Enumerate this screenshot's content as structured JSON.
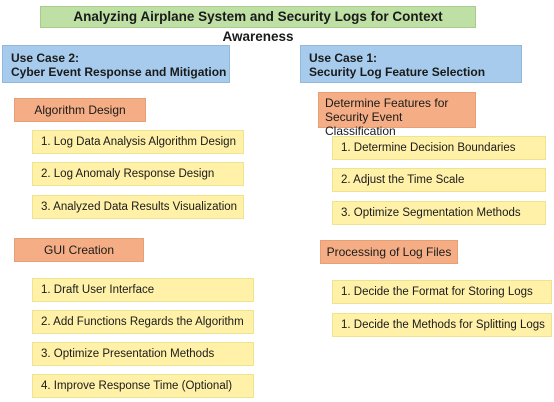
{
  "title": "Analyzing Airplane System and Security Logs for Context Awareness",
  "use_case_2": {
    "line1": "Use Case 2:",
    "line2": "Cyber Event Response and Mitigation",
    "algorithm_design": {
      "label": "Algorithm Design",
      "items": [
        "1. Log Data Analysis Algorithm Design",
        "2. Log Anomaly Response Design",
        "3. Analyzed Data Results Visualization"
      ]
    },
    "gui_creation": {
      "label": "GUI Creation",
      "items": [
        "1. Draft User Interface",
        "2. Add Functions Regards the Algorithm",
        "3. Optimize Presentation Methods",
        "4. Improve Response Time (Optional)"
      ]
    }
  },
  "use_case_1": {
    "line1": "Use Case 1:",
    "line2": "Security Log Feature Selection",
    "determine_features": {
      "line1": "Determine Features for",
      "line2": "Security Event Classification",
      "items": [
        "1. Determine Decision Boundaries",
        "2. Adjust the Time Scale",
        "3. Optimize Segmentation Methods"
      ]
    },
    "processing": {
      "label": "Processing of Log Files",
      "items": [
        "1. Decide the Format for Storing Logs",
        "1. Decide the Methods for Splitting Logs"
      ]
    }
  }
}
